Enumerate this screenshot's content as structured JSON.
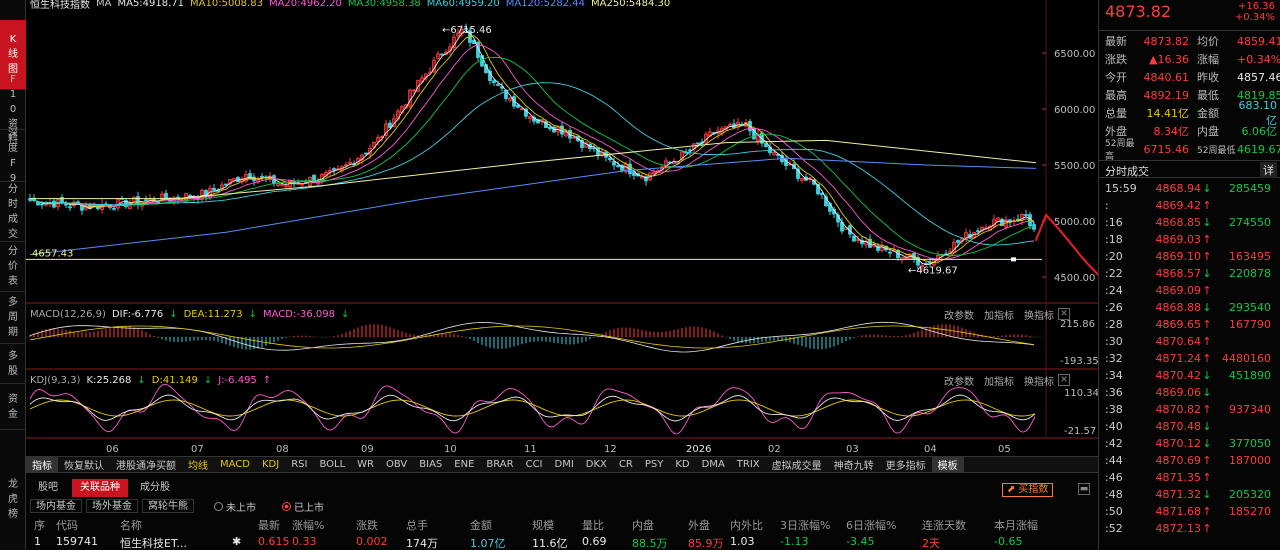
{
  "app": {
    "title_left": "恒生科技指数",
    "ma_legend": [
      {
        "label": "MA",
        "color": "#c8c8c8"
      },
      {
        "label": "MA5:4918.71",
        "color": "#e8e8e8"
      },
      {
        "label": "MA10:5008.83",
        "color": "#e6c800"
      },
      {
        "label": "MA20:4962.20",
        "color": "#ff5ad2"
      },
      {
        "label": "MA30:4958.38",
        "color": "#12c84a"
      },
      {
        "label": "MA60:4959.20",
        "color": "#3fd0e0"
      },
      {
        "label": "MA120:5282.44",
        "color": "#5a8cff"
      },
      {
        "label": "MA250:5484.30",
        "color": "#f0f0a0"
      }
    ]
  },
  "left_tabs": [
    {
      "label": "K线图",
      "active": true
    },
    {
      "label": "F10资料",
      "active": false
    },
    {
      "label": "深度F9",
      "active": false
    },
    {
      "label": "分时成交",
      "active": false
    },
    {
      "label": "分价表",
      "active": false
    },
    {
      "label": "多周期",
      "active": false
    },
    {
      "label": "多股",
      "active": false
    },
    {
      "label": "资金",
      "active": false
    },
    {
      "label": "龙虎榜",
      "active": false
    }
  ],
  "main_chart": {
    "price_ticks": [
      "6500.00",
      "6000.00",
      "5500.00",
      "5000.00",
      "4500.00"
    ],
    "high_label": "6715.46",
    "low_label": "4619.67",
    "level_label": "4657.43",
    "colors": {
      "up": "#ff3c3c",
      "down": "#3fd0e0",
      "bg": "#000000"
    }
  },
  "macd": {
    "title": "MACD(12,26,9)",
    "dif": "DIF:-6.776",
    "dea": "DEA:11.273",
    "macd": "MACD:-36.098",
    "ticks": [
      "215.86",
      "-193.35"
    ]
  },
  "kdj": {
    "title": "KDJ(9,3,3)",
    "k": "K:25.268",
    "d": "D:41.149",
    "j": "J:-6.495",
    "ticks": [
      "110.34",
      "-21.57"
    ]
  },
  "indicator_tools": [
    "改参数",
    "加指标",
    "换指标"
  ],
  "x_axis": [
    "06",
    "07",
    "08",
    "09",
    "10",
    "11",
    "12",
    "2026",
    "02",
    "03",
    "04",
    "05"
  ],
  "indicator_bar": [
    "指标",
    "恢复默认",
    "港股通净买额",
    "均线",
    "MACD",
    "KDJ",
    "RSI",
    "BOLL",
    "WR",
    "OBV",
    "BIAS",
    "ENE",
    "BRAR",
    "CCI",
    "DMI",
    "DKX",
    "CR",
    "PSY",
    "KD",
    "DMA",
    "TRIX",
    "虚拟成交量",
    "神奇九转",
    "更多指标",
    "模板"
  ],
  "bottom_tabs": [
    "股吧",
    "关联品种",
    "成分股"
  ],
  "fund_tabs": [
    "场内基金",
    "场外基金",
    "窝轮牛熊"
  ],
  "listing_filter": {
    "unlisted": "未上市",
    "listed": "已上市"
  },
  "buy_index_button": "买指数",
  "table_headers": [
    "序",
    "代码",
    "名称",
    "最新",
    "涨幅%",
    "涨跌",
    "总手",
    "金额",
    "规模",
    "量比",
    "内盘",
    "外盘",
    "内外比",
    "3日涨幅%",
    "6日涨幅%",
    "连涨天数",
    "本月涨幅"
  ],
  "table_row": [
    "1",
    "159741",
    "恒生科技ET...",
    "0.615",
    "0.33",
    "0.002",
    "174万",
    "1.07亿",
    "11.6亿",
    "0.69",
    "88.5万",
    "85.9万",
    "1.03",
    "-1.13",
    "-3.45",
    "2天",
    "-0.65"
  ],
  "quote": {
    "price": "4873.82",
    "change": "+16.36",
    "change_pct": "+0.34%",
    "rows": [
      [
        "最新",
        "4873.82",
        "均价",
        "4859.41"
      ],
      [
        "涨跌",
        "▲16.36",
        "涨幅",
        "+0.34%"
      ],
      [
        "今开",
        "4840.61",
        "昨收",
        "4857.46"
      ],
      [
        "最高",
        "4892.19",
        "最低",
        "4819.85"
      ],
      [
        "总量",
        "14.41亿",
        "金额",
        "683.10亿"
      ],
      [
        "外盘",
        "8.34亿",
        "内盘",
        "6.06亿"
      ],
      [
        "52周最高",
        "6715.46",
        "52周最低",
        "4619.67"
      ]
    ]
  },
  "ticks_panel": {
    "title": "分时成交",
    "detail": "详",
    "rows": [
      [
        "15:59",
        "4868.94",
        "↓",
        "285459"
      ],
      [
        ":",
        "4869.42",
        "↑",
        ""
      ],
      [
        ":16",
        "4868.85",
        "↓",
        "274550"
      ],
      [
        ":18",
        "4869.03",
        "↑",
        ""
      ],
      [
        ":20",
        "4869.10",
        "↑",
        "163495"
      ],
      [
        ":22",
        "4868.57",
        "↓",
        "220878"
      ],
      [
        ":24",
        "4869.09",
        "↑",
        ""
      ],
      [
        ":26",
        "4868.88",
        "↓",
        "293540"
      ],
      [
        ":28",
        "4869.65",
        "↑",
        "167790"
      ],
      [
        ":30",
        "4870.64",
        "↑",
        ""
      ],
      [
        ":32",
        "4871.24",
        "↑",
        "4480160"
      ],
      [
        ":34",
        "4870.42",
        "↓",
        "451890"
      ],
      [
        ":36",
        "4869.06",
        "↓",
        ""
      ],
      [
        ":38",
        "4870.82",
        "↑",
        "937340"
      ],
      [
        ":40",
        "4870.48",
        "↓",
        ""
      ],
      [
        ":42",
        "4870.12",
        "↓",
        "377050"
      ],
      [
        ":44",
        "4870.69",
        "↑",
        "187000"
      ],
      [
        ":46",
        "4871.35",
        "↑",
        ""
      ],
      [
        ":48",
        "4871.32",
        "↓",
        "205320"
      ],
      [
        ":50",
        "4871.68",
        "↑",
        "185270"
      ],
      [
        ":52",
        "4872.13",
        "↑",
        ""
      ]
    ]
  }
}
